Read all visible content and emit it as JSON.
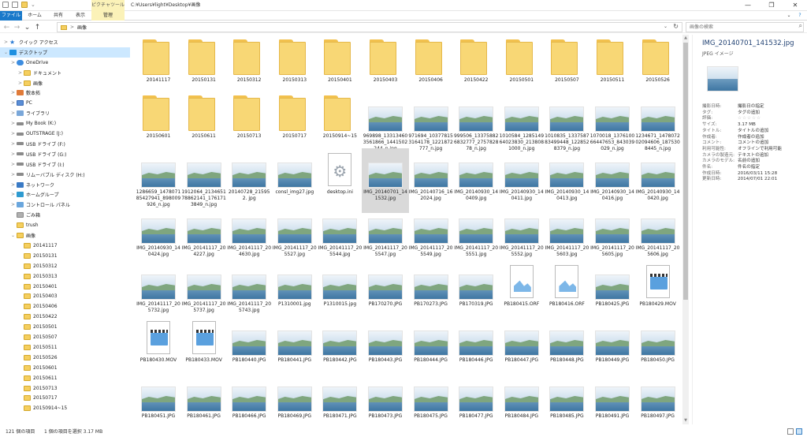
{
  "titlebar": {
    "ribbon_context": "ピクチャツール",
    "path_title": "C:¥Users¥light¥Desktop¥画像",
    "minimize": "—",
    "maximize": "❐",
    "close": "✕"
  },
  "ribbon": {
    "file": "ファイル",
    "home": "ホーム",
    "share": "共有",
    "view": "表示",
    "manage": "管理",
    "expand": "⌄",
    "help": "?"
  },
  "nav": {
    "back": "←",
    "forward": "→",
    "recent": "⌄",
    "up": "↑"
  },
  "address": {
    "chevron": ">",
    "crumb": "画像",
    "dropdown": "⌄",
    "refresh": "↻"
  },
  "search": {
    "placeholder": "画像の検索",
    "icon": "⌕"
  },
  "nav_pane": [
    {
      "label": "クイック アクセス",
      "icon": "star-icon",
      "ex": ">",
      "indent": 0
    },
    {
      "label": "デスクトップ",
      "icon": "desktop-icon",
      "ex": "⌄",
      "indent": 0,
      "selected": true
    },
    {
      "label": "OneDrive",
      "icon": "cloud-icon",
      "ex": ">",
      "indent": 1
    },
    {
      "label": "ドキュメント",
      "icon": "folder-icon",
      "ex": ">",
      "indent": 2
    },
    {
      "label": "画像",
      "icon": "folder-icon",
      "ex": ">",
      "indent": 2
    },
    {
      "label": "敷本拓",
      "icon": "user-icon",
      "ex": ">",
      "indent": 1
    },
    {
      "label": "PC",
      "icon": "pc-icon",
      "ex": ">",
      "indent": 1
    },
    {
      "label": "ライブラリ",
      "icon": "library-icon",
      "ex": ">",
      "indent": 1
    },
    {
      "label": "My Book (K:)",
      "icon": "drive-icon",
      "ex": ">",
      "indent": 1
    },
    {
      "label": "OUTSTRAGE (J:)",
      "icon": "drive-icon",
      "ex": ">",
      "indent": 1
    },
    {
      "label": "USB ドライブ (F:)",
      "icon": "drive-icon",
      "ex": ">",
      "indent": 1
    },
    {
      "label": "USB ドライブ (G:)",
      "icon": "drive-icon",
      "ex": ">",
      "indent": 1
    },
    {
      "label": "USB ドライブ (I:)",
      "icon": "drive-icon",
      "ex": ">",
      "indent": 1
    },
    {
      "label": "リムーバブル ディスク (H:)",
      "icon": "drive-icon",
      "ex": ">",
      "indent": 1
    },
    {
      "label": "ネットワーク",
      "icon": "network-icon",
      "ex": ">",
      "indent": 1
    },
    {
      "label": "ホームグループ",
      "icon": "homegroup-icon",
      "ex": ">",
      "indent": 1
    },
    {
      "label": "コントロール パネル",
      "icon": "control-panel-icon",
      "ex": ">",
      "indent": 1
    },
    {
      "label": "ごみ箱",
      "icon": "trash-icon",
      "ex": "",
      "indent": 1
    },
    {
      "label": "trush",
      "icon": "folder-icon",
      "ex": "",
      "indent": 1
    },
    {
      "label": "画像",
      "icon": "folder-icon",
      "ex": "⌄",
      "indent": 1
    },
    {
      "label": "20141117",
      "icon": "folder-icon",
      "ex": "",
      "indent": 2
    },
    {
      "label": "20150131",
      "icon": "folder-icon",
      "ex": "",
      "indent": 2
    },
    {
      "label": "20150312",
      "icon": "folder-icon",
      "ex": "",
      "indent": 2
    },
    {
      "label": "20150313",
      "icon": "folder-icon",
      "ex": "",
      "indent": 2
    },
    {
      "label": "20150401",
      "icon": "folder-icon",
      "ex": "",
      "indent": 2
    },
    {
      "label": "20150403",
      "icon": "folder-icon",
      "ex": "",
      "indent": 2
    },
    {
      "label": "20150406",
      "icon": "folder-icon",
      "ex": "",
      "indent": 2
    },
    {
      "label": "20150422",
      "icon": "folder-icon",
      "ex": "",
      "indent": 2
    },
    {
      "label": "20150501",
      "icon": "folder-icon",
      "ex": "",
      "indent": 2
    },
    {
      "label": "20150507",
      "icon": "folder-icon",
      "ex": "",
      "indent": 2
    },
    {
      "label": "20150511",
      "icon": "folder-icon",
      "ex": "",
      "indent": 2
    },
    {
      "label": "20150526",
      "icon": "folder-icon",
      "ex": "",
      "indent": 2
    },
    {
      "label": "20150601",
      "icon": "folder-icon",
      "ex": "",
      "indent": 2
    },
    {
      "label": "20150611",
      "icon": "folder-icon",
      "ex": "",
      "indent": 2
    },
    {
      "label": "20150713",
      "icon": "folder-icon",
      "ex": "",
      "indent": 2
    },
    {
      "label": "20150717",
      "icon": "folder-icon",
      "ex": "",
      "indent": 2
    },
    {
      "label": "20150914~15",
      "icon": "folder-icon",
      "ex": "",
      "indent": 2
    }
  ],
  "items": [
    {
      "label": "20141117",
      "type": "folder"
    },
    {
      "label": "20150131",
      "type": "folder"
    },
    {
      "label": "20150312",
      "type": "folder"
    },
    {
      "label": "20150313",
      "type": "folder"
    },
    {
      "label": "20150401",
      "type": "folder"
    },
    {
      "label": "20150403",
      "type": "folder"
    },
    {
      "label": "20150406",
      "type": "folder"
    },
    {
      "label": "20150422",
      "type": "folder"
    },
    {
      "label": "20150501",
      "type": "folder"
    },
    {
      "label": "20150507",
      "type": "folder"
    },
    {
      "label": "20150511",
      "type": "folder"
    },
    {
      "label": "20150526",
      "type": "folder"
    },
    {
      "label": "20150601",
      "type": "folder"
    },
    {
      "label": "20150611",
      "type": "folder"
    },
    {
      "label": "20150713",
      "type": "folder"
    },
    {
      "label": "20150717",
      "type": "folder"
    },
    {
      "label": "20150914~15",
      "type": "folder"
    },
    {
      "label": "969898_13313460 3561866_1441502 244_n.jpg",
      "type": "image"
    },
    {
      "label": "971694_10377815 3164178_1221872 777_n.jpg",
      "type": "image"
    },
    {
      "label": "999506_13375882 6832777_2757828 78_n.jpg",
      "type": "image"
    },
    {
      "label": "1010584_1285149 64023830_213808 1000_n.jpg",
      "type": "image"
    },
    {
      "label": "1010835_1337587 83499448_122852 8379_n.jpg",
      "type": "image"
    },
    {
      "label": "1070018_1376100 66447653_843039 029_n.jpg",
      "type": "image"
    },
    {
      "label": "1234671_1478072 02094606_187530 8445_n.jpg",
      "type": "image"
    },
    {
      "label": "1286659_1478071 85427941_898009 926_n.jpg",
      "type": "image"
    },
    {
      "label": "1912064_2134651 78862141_176171 3849_n.jpg",
      "type": "image"
    },
    {
      "label": "20140728_215952. jpg",
      "type": "image"
    },
    {
      "label": "consl_img27.jpg",
      "type": "image"
    },
    {
      "label": "desktop.ini",
      "type": "settings"
    },
    {
      "label": "IMG_20140701_14 1532.jpg",
      "type": "image",
      "selected": true
    },
    {
      "label": "IMG_20140716_16 2024.jpg",
      "type": "image"
    },
    {
      "label": "IMG_20140930_14 0409.jpg",
      "type": "image"
    },
    {
      "label": "IMG_20140930_14 0411.jpg",
      "type": "image"
    },
    {
      "label": "IMG_20140930_14 0413.jpg",
      "type": "image"
    },
    {
      "label": "IMG_20140930_14 0416.jpg",
      "type": "image"
    },
    {
      "label": "IMG_20140930_14 0420.jpg",
      "type": "image"
    },
    {
      "label": "IMG_20140930_14 0424.jpg",
      "type": "image"
    },
    {
      "label": "IMG_20141117_20 4227.jpg",
      "type": "image"
    },
    {
      "label": "IMG_20141117_20 4630.jpg",
      "type": "image"
    },
    {
      "label": "IMG_20141117_20 5527.jpg",
      "type": "image"
    },
    {
      "label": "IMG_20141117_20 5544.jpg",
      "type": "image"
    },
    {
      "label": "IMG_20141117_20 5547.jpg",
      "type": "image"
    },
    {
      "label": "IMG_20141117_20 5549.jpg",
      "type": "image"
    },
    {
      "label": "IMG_20141117_20 5551.jpg",
      "type": "image"
    },
    {
      "label": "IMG_20141117_20 5552.jpg",
      "type": "image"
    },
    {
      "label": "IMG_20141117_20 5603.jpg",
      "type": "image"
    },
    {
      "label": "IMG_20141117_20 5605.jpg",
      "type": "image"
    },
    {
      "label": "IMG_20141117_20 5606.jpg",
      "type": "image"
    },
    {
      "label": "IMG_20141117_20 5732.jpg",
      "type": "image"
    },
    {
      "label": "IMG_20141117_20 5737.jpg",
      "type": "image"
    },
    {
      "label": "IMG_20141117_20 5743.jpg",
      "type": "image"
    },
    {
      "label": "P1310001.jpg",
      "type": "image"
    },
    {
      "label": "P1310015.jpg",
      "type": "image"
    },
    {
      "label": "PB170270.JPG",
      "type": "image"
    },
    {
      "label": "PB170273.JPG",
      "type": "image"
    },
    {
      "label": "PB170319.JPG",
      "type": "image"
    },
    {
      "label": "PB180415.ORF",
      "type": "raw"
    },
    {
      "label": "PB180416.ORF",
      "type": "raw"
    },
    {
      "label": "PB180425.JPG",
      "type": "image"
    },
    {
      "label": "PB180429.MOV",
      "type": "video"
    },
    {
      "label": "PB180430.MOV",
      "type": "video"
    },
    {
      "label": "PB180433.MOV",
      "type": "video"
    },
    {
      "label": "PB180440.JPG",
      "type": "image"
    },
    {
      "label": "PB180441.JPG",
      "type": "image"
    },
    {
      "label": "PB180442.JPG",
      "type": "image"
    },
    {
      "label": "PB180443.JPG",
      "type": "image"
    },
    {
      "label": "PB180444.JPG",
      "type": "image"
    },
    {
      "label": "PB180446.JPG",
      "type": "image"
    },
    {
      "label": "PB180447.JPG",
      "type": "image"
    },
    {
      "label": "PB180448.JPG",
      "type": "image"
    },
    {
      "label": "PB180449.JPG",
      "type": "image"
    },
    {
      "label": "PB180450.JPG",
      "type": "image"
    },
    {
      "label": "PB180451.JPG",
      "type": "image"
    },
    {
      "label": "PB180461.JPG",
      "type": "image"
    },
    {
      "label": "PB180466.JPG",
      "type": "image"
    },
    {
      "label": "PB180469.JPG",
      "type": "image"
    },
    {
      "label": "PB180471.JPG",
      "type": "image"
    },
    {
      "label": "PB180473.JPG",
      "type": "image"
    },
    {
      "label": "PB180475.JPG",
      "type": "image"
    },
    {
      "label": "PB180477.JPG",
      "type": "image"
    },
    {
      "label": "PB180484.JPG",
      "type": "image"
    },
    {
      "label": "PB180485.JPG",
      "type": "image"
    },
    {
      "label": "PB180491.JPG",
      "type": "image"
    },
    {
      "label": "PB180497.JPG",
      "type": "image"
    }
  ],
  "details": {
    "filename": "IMG_20140701_141532.jpg",
    "type": "JPEG イメージ",
    "properties": [
      {
        "key": "撮影日時:",
        "value": "撮影日の指定"
      },
      {
        "key": "タグ:",
        "value": "タグの追加"
      },
      {
        "key": "評価:",
        "value": "☆☆☆☆☆"
      },
      {
        "key": "サイズ:",
        "value": "3.17 MB"
      },
      {
        "key": "タイトル:",
        "value": "タイトルの追加"
      },
      {
        "key": "作成者:",
        "value": "作成者の追加"
      },
      {
        "key": "コメント:",
        "value": "コメントの追加"
      },
      {
        "key": "利用可能性:",
        "value": "オフラインで利用可能"
      },
      {
        "key": "カメラの製造元:",
        "value": "テキストの追加"
      },
      {
        "key": "カメラのモデル:",
        "value": "名前の追加"
      },
      {
        "key": "件名:",
        "value": "件名の指定"
      },
      {
        "key": "作成日時:",
        "value": "2016/03/11 15:28"
      },
      {
        "key": "更新日時:",
        "value": "2014/07/01 22:01"
      }
    ]
  },
  "scrollbar": {
    "up": "▲",
    "down": "▼"
  },
  "status": {
    "count": "121 個の項目",
    "selection": "1 個の項目を選択  3.17 MB"
  },
  "colors": {
    "accent": "#1979ca",
    "selection": "#cce8ff",
    "folder": "#f8d775",
    "context_tab": "#fbf2b8"
  }
}
